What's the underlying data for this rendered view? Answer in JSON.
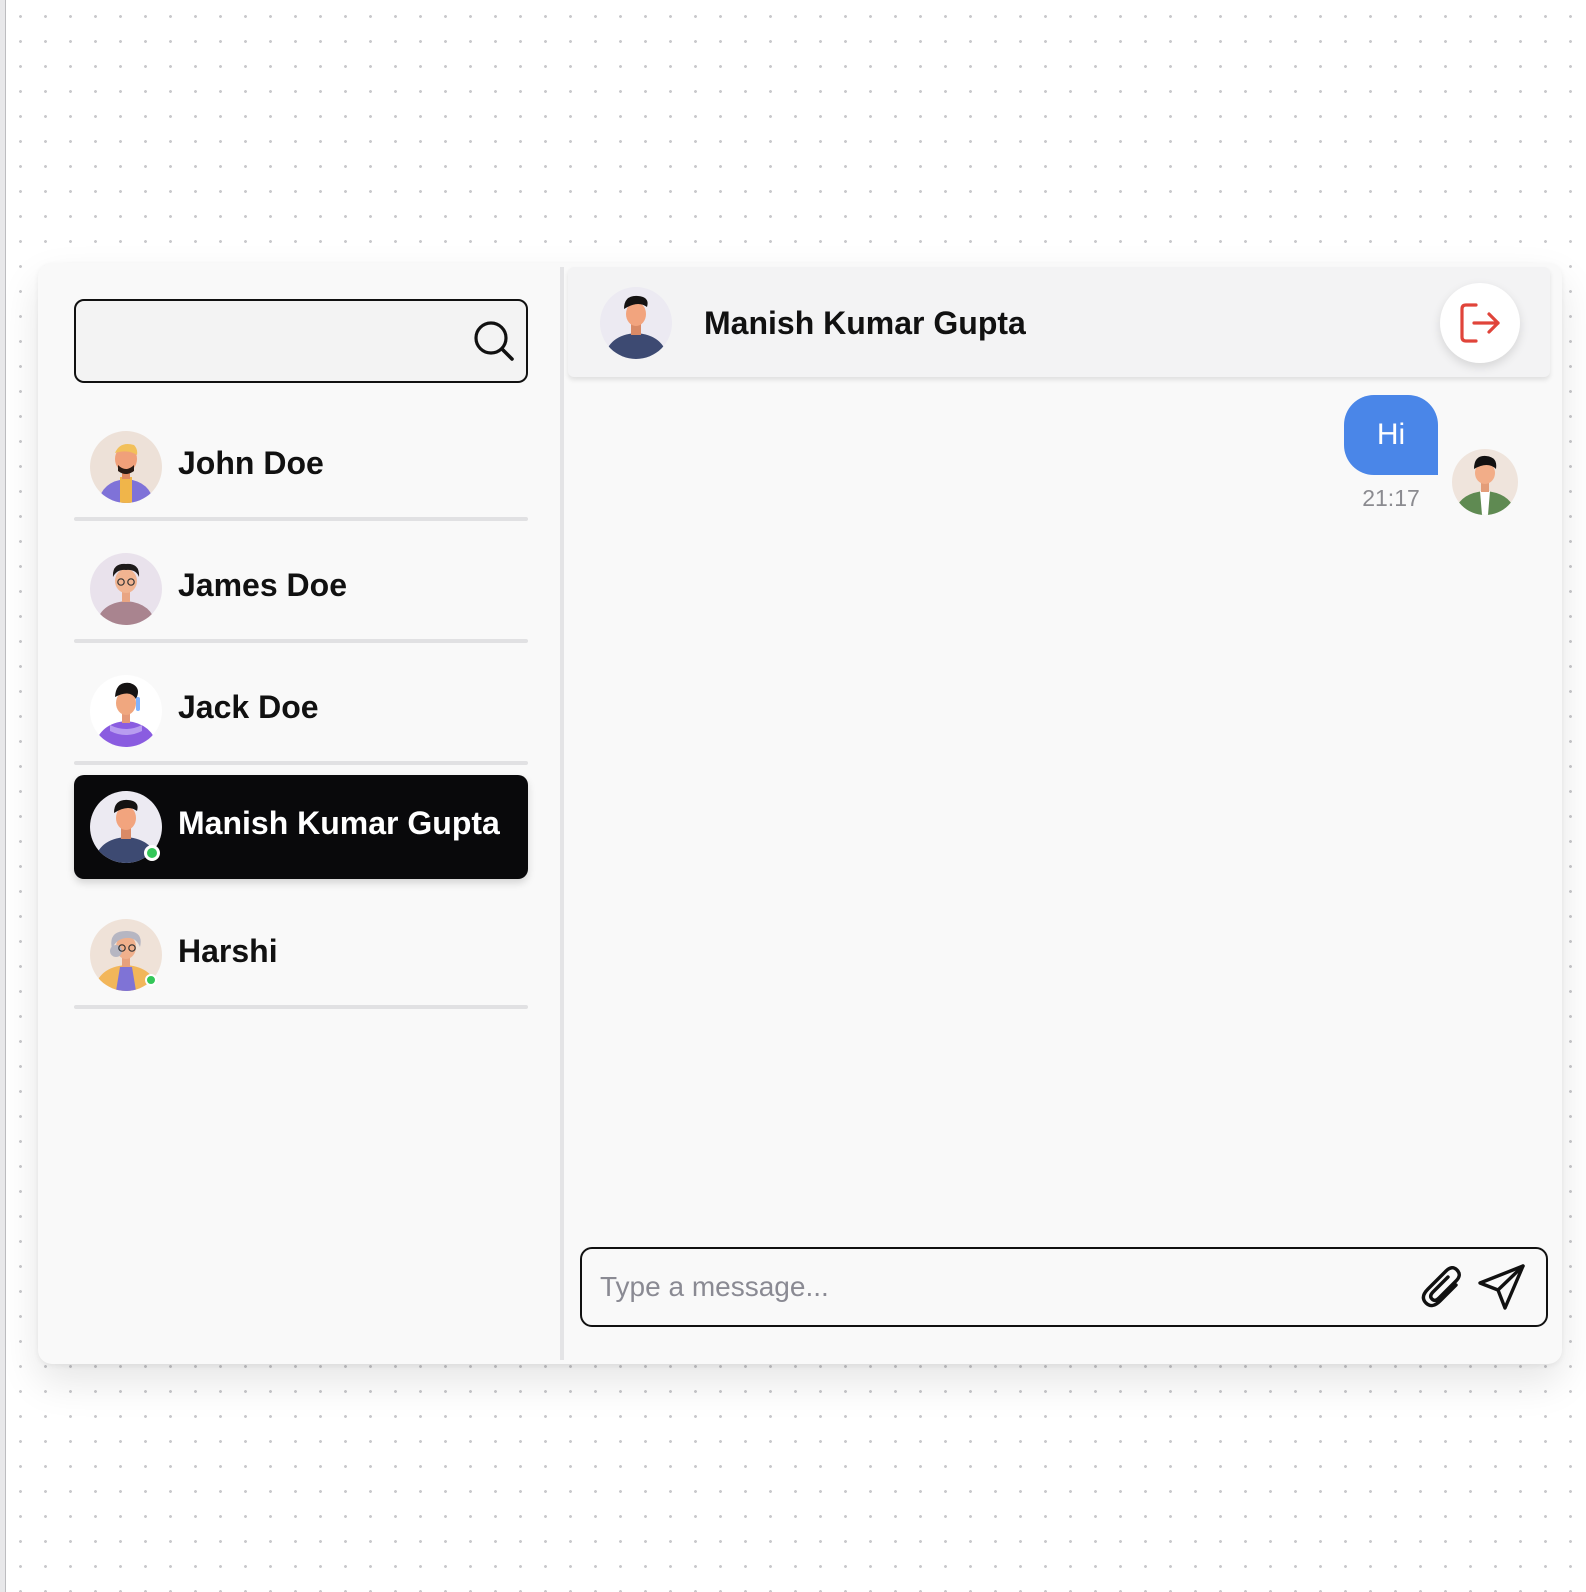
{
  "search": {
    "placeholder": "",
    "value": ""
  },
  "contacts": [
    {
      "name": "John Doe",
      "online": false,
      "active": false,
      "avatar": "avatar-john"
    },
    {
      "name": "James Doe",
      "online": false,
      "active": false,
      "avatar": "avatar-james"
    },
    {
      "name": "Jack Doe",
      "online": false,
      "active": false,
      "avatar": "avatar-jack"
    },
    {
      "name": "Manish Kumar Gupta",
      "online": true,
      "active": true,
      "avatar": "avatar-manish"
    },
    {
      "name": "Harshi",
      "online": true,
      "active": false,
      "avatar": "avatar-harshi"
    }
  ],
  "chat": {
    "title": "Manish Kumar Gupta",
    "logout_icon": "logout-icon",
    "messages": [
      {
        "text": "Hi",
        "time": "21:17",
        "sender": "me"
      }
    ]
  },
  "composer": {
    "placeholder": "Type a message...",
    "value": "",
    "attach_icon": "paperclip-icon",
    "send_icon": "send-icon"
  },
  "colors": {
    "accent_bubble": "#4a86e8",
    "active_contact_bg": "#09090b",
    "online": "#34c759",
    "logout": "#e0443a"
  }
}
